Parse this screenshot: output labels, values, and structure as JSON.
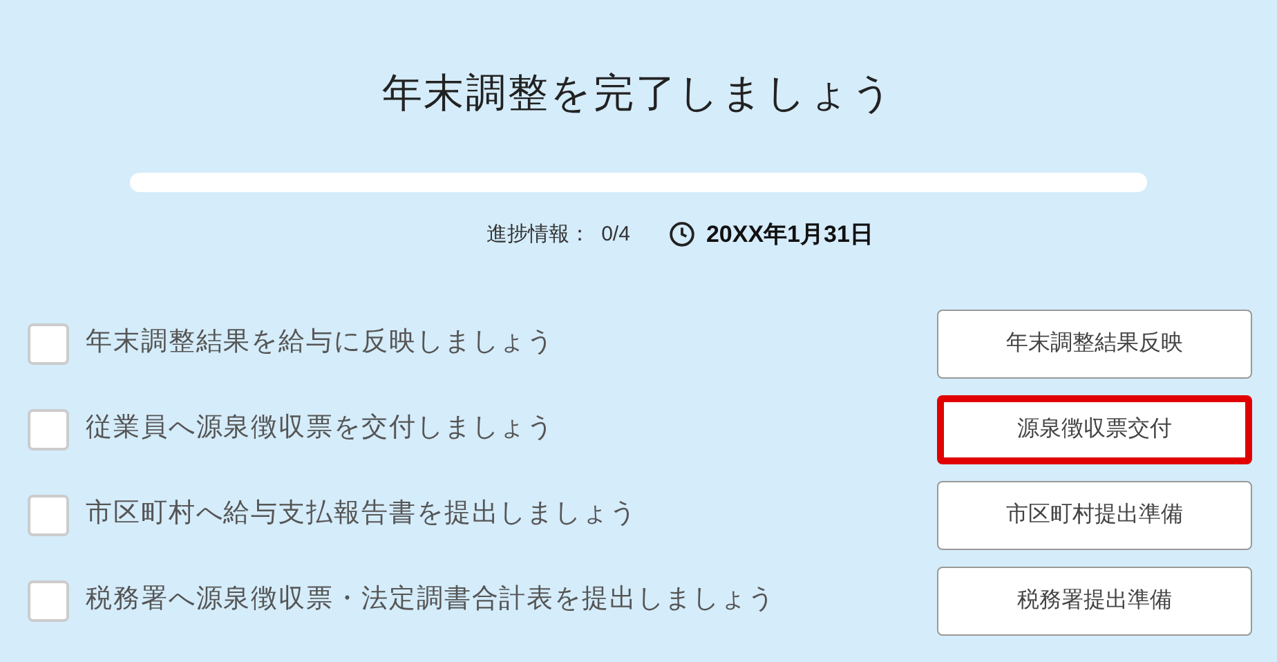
{
  "title": "年末調整を完了しましょう",
  "progress": {
    "level": 0
  },
  "status": {
    "label": "進捗情報：",
    "count": "0/4",
    "deadline": "20XX年1月31日"
  },
  "tasks": [
    {
      "label": "年末調整結果を給与に反映しましょう",
      "checked": false,
      "button": "年末調整結果反映",
      "highlighted": false
    },
    {
      "label": "従業員へ源泉徴収票を交付しましょう",
      "checked": false,
      "button": "源泉徴収票交付",
      "highlighted": true
    },
    {
      "label": "市区町村へ給与支払報告書を提出しましょう",
      "checked": false,
      "button": "市区町村提出準備",
      "highlighted": false
    },
    {
      "label": "税務署へ源泉徴収票・法定調書合計表を提出しましょう",
      "checked": false,
      "button": "税務署提出準備",
      "highlighted": false
    }
  ]
}
